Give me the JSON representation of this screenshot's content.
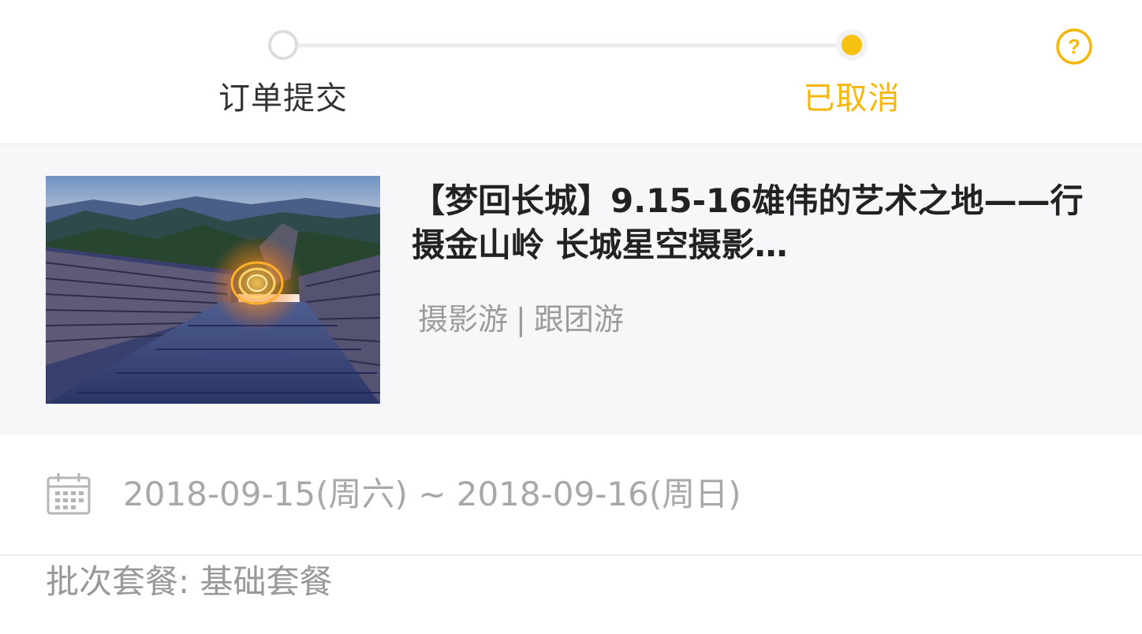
{
  "progress": {
    "steps": [
      {
        "label": "订单提交",
        "state": "done"
      },
      {
        "label": "已取消",
        "state": "current"
      }
    ],
    "help_icon": "question-circle-icon",
    "help_glyph": "?",
    "active_color": "#f7c112"
  },
  "product": {
    "title": "【梦回长城】9.15-16雄伟的艺术之地——行摄金山岭 长城星空摄影…",
    "tags": [
      "摄影游",
      "跟团游"
    ],
    "tag_separator": "|",
    "image": "great-wall-light-painting-thumbnail"
  },
  "date": {
    "icon": "calendar-icon",
    "range": "2018-09-15(周六) ~ 2018-09-16(周日)"
  },
  "package": {
    "text": "批次套餐: 基础套餐"
  }
}
